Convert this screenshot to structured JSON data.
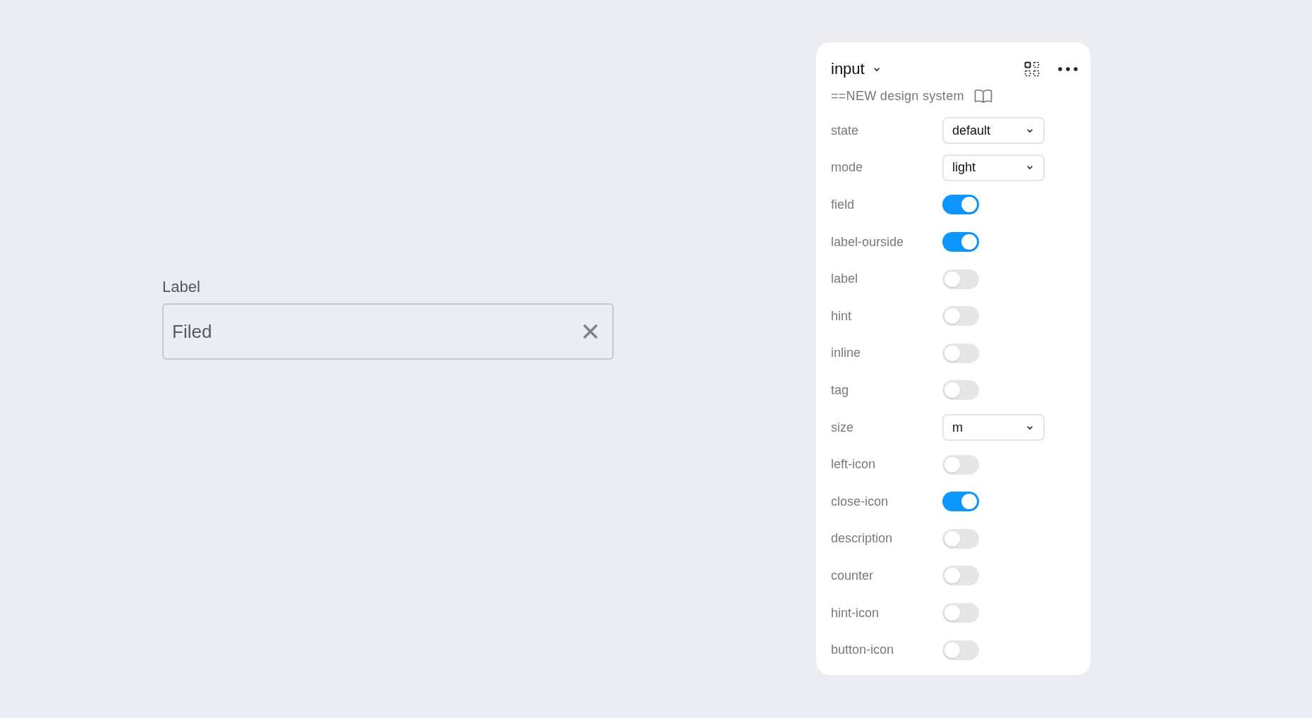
{
  "preview": {
    "label": "Label",
    "value": "Filed",
    "clear_icon": true
  },
  "panel": {
    "title": "input",
    "subtitle": "==NEW design system",
    "properties": [
      {
        "name": "state",
        "kind": "select",
        "value": "default"
      },
      {
        "name": "mode",
        "kind": "select",
        "value": "light"
      },
      {
        "name": "field",
        "kind": "toggle",
        "on": true
      },
      {
        "name": "label-ourside",
        "kind": "toggle",
        "on": true
      },
      {
        "name": "label",
        "kind": "toggle",
        "on": false
      },
      {
        "name": "hint",
        "kind": "toggle",
        "on": false
      },
      {
        "name": "inline",
        "kind": "toggle",
        "on": false
      },
      {
        "name": "tag",
        "kind": "toggle",
        "on": false
      },
      {
        "name": "size",
        "kind": "select",
        "value": "m"
      },
      {
        "name": "left-icon",
        "kind": "toggle",
        "on": false
      },
      {
        "name": "close-icon",
        "kind": "toggle",
        "on": true
      },
      {
        "name": "description",
        "kind": "toggle",
        "on": false
      },
      {
        "name": "counter",
        "kind": "toggle",
        "on": false
      },
      {
        "name": "hint-icon",
        "kind": "toggle",
        "on": false
      },
      {
        "name": "button-icon",
        "kind": "toggle",
        "on": false
      }
    ]
  }
}
